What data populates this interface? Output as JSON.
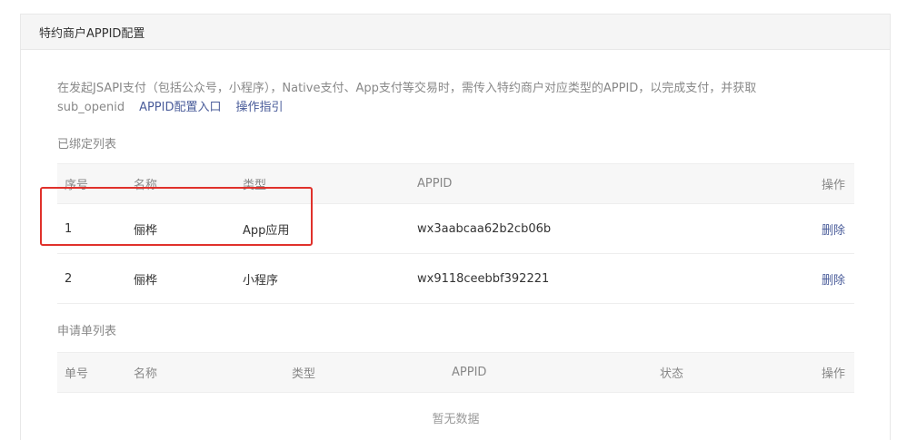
{
  "panel": {
    "title": "特约商户APPID配置"
  },
  "description": {
    "text": "在发起JSAPI支付（包括公众号，小程序），Native支付、App支付等交易时，需传入特约商户对应类型的APPID，以完成支付，并获取sub_openid",
    "link_config": "APPID配置入口",
    "link_guide": "操作指引"
  },
  "bound_list": {
    "title": "已绑定列表",
    "headers": [
      "序号",
      "名称",
      "类型",
      "APPID",
      "操作"
    ],
    "rows": [
      {
        "index": "1",
        "name": "俪桦",
        "type": "App应用",
        "appid": "wx3aabcaa62b2cb06b",
        "action": "删除"
      },
      {
        "index": "2",
        "name": "俪桦",
        "type": "小程序",
        "appid": "wx9118ceebbf392221",
        "action": "删除"
      }
    ]
  },
  "application_list": {
    "title": "申请单列表",
    "headers": [
      "单号",
      "名称",
      "类型",
      "APPID",
      "状态",
      "操作"
    ],
    "empty_text": "暂无数据"
  },
  "colors": {
    "link": "#4a5c9a",
    "highlight": "#e0312b"
  }
}
